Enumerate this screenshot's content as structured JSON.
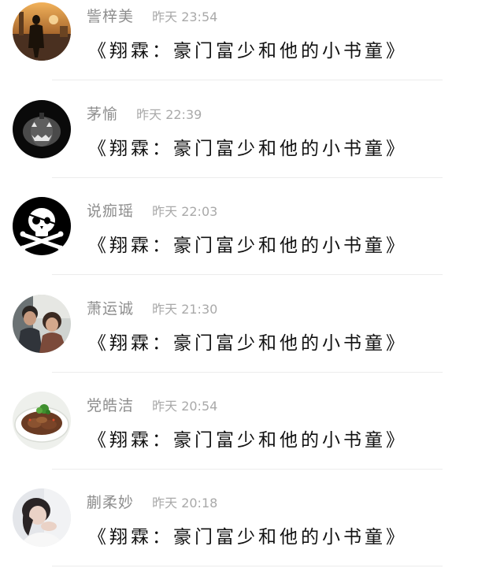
{
  "messages": [
    {
      "name": "訾梓美",
      "time": "昨天 23:54",
      "text": "《翔霖：豪门富少和他的小书童》",
      "avatar_icon": "silhouette-street-avatar-icon"
    },
    {
      "name": "茅愉",
      "time": "昨天 22:39",
      "text": "《翔霖：豪门富少和他的小书童》",
      "avatar_icon": "jack-o-lantern-avatar-icon"
    },
    {
      "name": "说痂瑶",
      "time": "昨天 22:03",
      "text": "《翔霖：豪门富少和他的小书童》",
      "avatar_icon": "skull-crossbones-avatar-icon"
    },
    {
      "name": "萧运诚",
      "time": "昨天 21:30",
      "text": "《翔霖：豪门富少和他的小书童》",
      "avatar_icon": "couple-photo-avatar-icon"
    },
    {
      "name": "党皓洁",
      "time": "昨天 20:54",
      "text": "《翔霖：豪门富少和他的小书童》",
      "avatar_icon": "food-plate-avatar-icon"
    },
    {
      "name": "蒯柔妙",
      "time": "昨天 20:18",
      "text": "《翔霖：豪门富少和他的小书童》",
      "avatar_icon": "portrait-photo-avatar-icon"
    }
  ]
}
